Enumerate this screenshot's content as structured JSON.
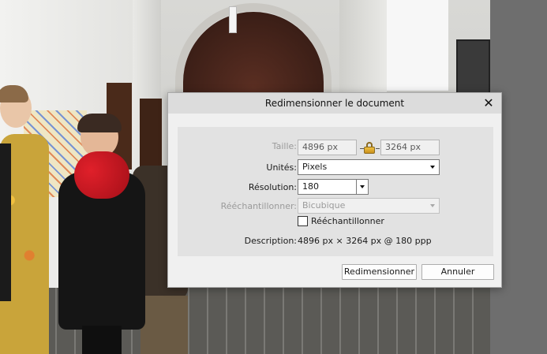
{
  "dialog": {
    "title": "Redimensionner le document",
    "close_icon": "close-icon",
    "size_label": "Taille:",
    "width_value": "4896 px",
    "height_value": "3264 px",
    "lock_icon": "padlock-icon",
    "units_label": "Unités:",
    "units_value": "Pixels",
    "resolution_label": "Résolution:",
    "resolution_value": "180",
    "resample_label": "Rééchantillonner:",
    "resample_value": "Bicubique",
    "resample_checkbox_label": "Rééchantillonner",
    "resample_checked": false,
    "description_label": "Description:",
    "description_value": "4896 px × 3264 px @ 180 ppp",
    "resize_button": "Redimensionner",
    "cancel_button": "Annuler"
  },
  "colors": {
    "dialog_bg": "#f0f0f0",
    "titlebar_bg": "#dcdcdc",
    "content_bg": "#e2e2e2",
    "side_panel": "#6e6e6e",
    "disabled_text": "#9a9a9a"
  }
}
